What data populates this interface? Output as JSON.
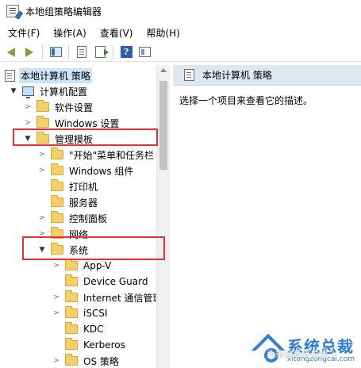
{
  "window": {
    "title": "本地组策略编辑器"
  },
  "menu": [
    "文件(F)",
    "操作(A)",
    "查看(V)",
    "帮助(H)"
  ],
  "toolbar": {
    "buttons": [
      "back-icon",
      "forward-icon",
      "show-hide-tree-icon",
      "properties-icon",
      "export-list-icon",
      "help-icon",
      "filter-icon"
    ]
  },
  "tree": {
    "root": "本地计算机 策略",
    "computer_config": "计算机配置",
    "software_settings": "软件设置",
    "windows_settings": "Windows 设置",
    "admin_templates": "管理模板",
    "start_menu": "\"开始\"菜单和任务栏",
    "windows_components": "Windows 组件",
    "printers": "打印机",
    "server": "服务器",
    "control_panel": "控制面板",
    "network": "网络",
    "system": "系统",
    "app_v": "App-V",
    "device_guard": "Device Guard",
    "internet_comm": "Internet 通信管理",
    "iscsi": "iSCSI",
    "kdc": "KDC",
    "kerberos": "Kerberos",
    "os_policy": "OS 策略"
  },
  "right_pane": {
    "header": "本地计算机 策略",
    "description": "选择一个项目来查看它的描述。"
  },
  "watermark": {
    "title": "系统总裁",
    "subtitle": "xitongzongcai.com",
    "caption": "头条@系统总裁"
  },
  "colors": {
    "highlight_box": "#e8303a",
    "selected_bg": "#cce4f7",
    "header_bg": "#dfe8f1",
    "brand": "#2f7fd8"
  }
}
